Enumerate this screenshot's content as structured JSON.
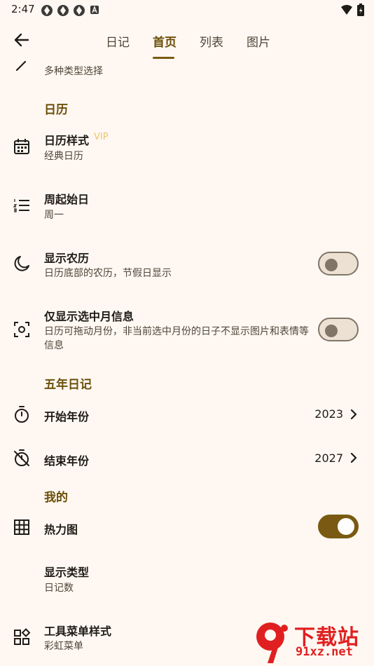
{
  "status_bar": {
    "time": "2:47"
  },
  "tabs": [
    {
      "label": "日记",
      "active": false
    },
    {
      "label": "首页",
      "active": true
    },
    {
      "label": "列表",
      "active": false
    },
    {
      "label": "图片",
      "active": false
    }
  ],
  "top_partial": {
    "subtitle": "多种类型选择"
  },
  "sections": {
    "calendar": "日历",
    "five_year": "五年日记",
    "mine": "我的"
  },
  "items": {
    "calendar_style": {
      "title": "日历样式",
      "badge": "VIP",
      "subtitle": "经典日历"
    },
    "week_start": {
      "title": "周起始日",
      "subtitle": "周一"
    },
    "lunar": {
      "title": "显示农历",
      "subtitle": "日历底部的农历，节假日显示",
      "toggle": false
    },
    "selected_month": {
      "title": "仅显示选中月信息",
      "subtitle": "日历可拖动月份，非当前选中月份的日子不显示图片和表情等信息",
      "toggle": false
    },
    "start_year": {
      "title": "开始年份",
      "value": "2023"
    },
    "end_year": {
      "title": "结束年份",
      "value": "2027"
    },
    "heatmap": {
      "title": "热力图",
      "toggle": true
    },
    "display_type": {
      "title": "显示类型",
      "subtitle": "日记数"
    },
    "toolbar_style": {
      "title": "工具菜单样式",
      "subtitle": "彩虹菜单"
    }
  },
  "watermark": {
    "text": "下载站",
    "url": "91xz.net",
    "logo": "9"
  },
  "colors": {
    "accent": "#7A5A12",
    "section": "#6B4F0A",
    "background": "#FFF8F2",
    "vip": "#E8C76A",
    "watermark": "#E02020"
  }
}
